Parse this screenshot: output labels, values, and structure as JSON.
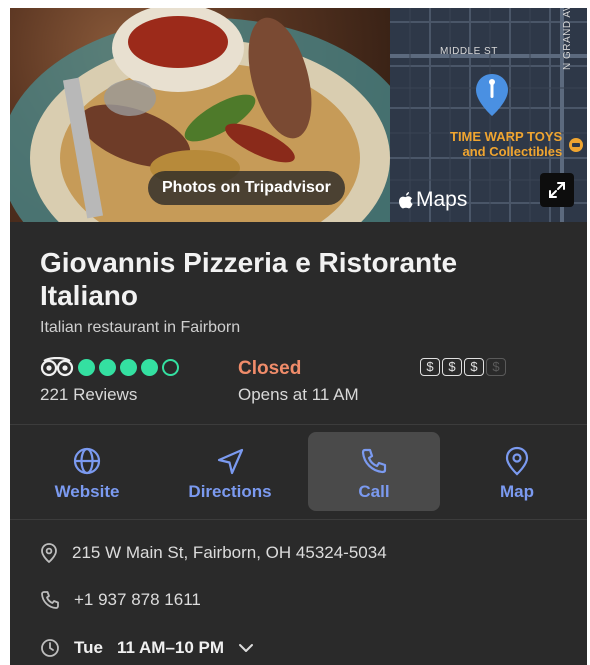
{
  "hero": {
    "photo_caption": "Photos on Tripadvisor",
    "maps_brand": "Maps",
    "map_labels": {
      "street_middle": "MIDDLE ST",
      "street_grand": "N GRAND AVE",
      "poi_line1": "TIME WARP TOYS",
      "poi_line2": "and Collectibles"
    }
  },
  "business": {
    "name": "Giovannis Pizzeria e Ristorante Italiano",
    "category": "Italian restaurant in Fairborn",
    "rating_filled": 4,
    "rating_max": 5,
    "reviews": "221 Reviews",
    "status": "Closed",
    "opens": "Opens at 11 AM",
    "price_symbols": [
      "$",
      "$",
      "$",
      "$"
    ],
    "price_level": 3
  },
  "actions": [
    {
      "label": "Website",
      "icon": "globe-icon"
    },
    {
      "label": "Directions",
      "icon": "navigation-arrow-icon"
    },
    {
      "label": "Call",
      "icon": "phone-icon"
    },
    {
      "label": "Map",
      "icon": "map-pin-icon"
    }
  ],
  "details": {
    "address": "215 W Main St, Fairborn, OH 45324-5034",
    "phone": "+1 937 878 1611",
    "hours_day": "Tue",
    "hours_time": "11 AM–10 PM"
  },
  "colors": {
    "background": "#2a2a2a",
    "accent": "#7b9af0",
    "tripadvisor_green": "#34e0a1",
    "closed": "#f08c6a"
  }
}
